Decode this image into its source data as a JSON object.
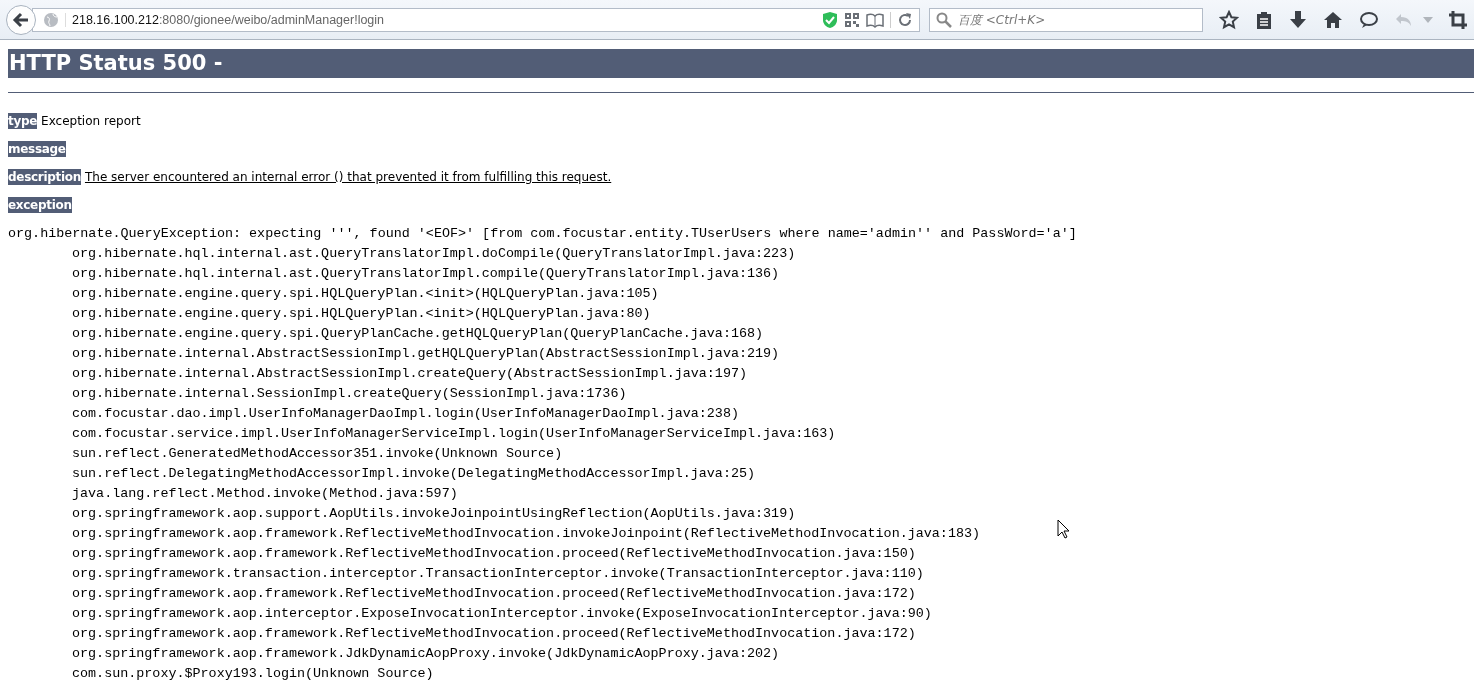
{
  "browser": {
    "url_host": "218.16.100.212",
    "url_path": ":8080/gionee/weibo/adminManager!login",
    "search_placeholder": "百度 <Ctrl+K>"
  },
  "page": {
    "title": "HTTP Status 500 -",
    "fields": [
      {
        "label": "type",
        "value": "Exception report",
        "underlined": false
      },
      {
        "label": "message"
      },
      {
        "label": "description",
        "value": "The server encountered an internal error () that prevented it from fulfilling this request.",
        "underlined": true
      },
      {
        "label": "exception"
      }
    ],
    "exception_header": "org.hibernate.QueryException: expecting ''', found '<EOF>' [from com.focustar.entity.TUserUsers where name='admin'' and PassWord='a']",
    "trace": [
      "org.hibernate.hql.internal.ast.QueryTranslatorImpl.doCompile(QueryTranslatorImpl.java:223)",
      "org.hibernate.hql.internal.ast.QueryTranslatorImpl.compile(QueryTranslatorImpl.java:136)",
      "org.hibernate.engine.query.spi.HQLQueryPlan.<init>(HQLQueryPlan.java:105)",
      "org.hibernate.engine.query.spi.HQLQueryPlan.<init>(HQLQueryPlan.java:80)",
      "org.hibernate.engine.query.spi.QueryPlanCache.getHQLQueryPlan(QueryPlanCache.java:168)",
      "org.hibernate.internal.AbstractSessionImpl.getHQLQueryPlan(AbstractSessionImpl.java:219)",
      "org.hibernate.internal.AbstractSessionImpl.createQuery(AbstractSessionImpl.java:197)",
      "org.hibernate.internal.SessionImpl.createQuery(SessionImpl.java:1736)",
      "com.focustar.dao.impl.UserInfoManagerDaoImpl.login(UserInfoManagerDaoImpl.java:238)",
      "com.focustar.service.impl.UserInfoManagerServiceImpl.login(UserInfoManagerServiceImpl.java:163)",
      "sun.reflect.GeneratedMethodAccessor351.invoke(Unknown Source)",
      "sun.reflect.DelegatingMethodAccessorImpl.invoke(DelegatingMethodAccessorImpl.java:25)",
      "java.lang.reflect.Method.invoke(Method.java:597)",
      "org.springframework.aop.support.AopUtils.invokeJoinpointUsingReflection(AopUtils.java:319)",
      "org.springframework.aop.framework.ReflectiveMethodInvocation.invokeJoinpoint(ReflectiveMethodInvocation.java:183)",
      "org.springframework.aop.framework.ReflectiveMethodInvocation.proceed(ReflectiveMethodInvocation.java:150)",
      "org.springframework.transaction.interceptor.TransactionInterceptor.invoke(TransactionInterceptor.java:110)",
      "org.springframework.aop.framework.ReflectiveMethodInvocation.proceed(ReflectiveMethodInvocation.java:172)",
      "org.springframework.aop.interceptor.ExposeInvocationInterceptor.invoke(ExposeInvocationInterceptor.java:90)",
      "org.springframework.aop.framework.ReflectiveMethodInvocation.proceed(ReflectiveMethodInvocation.java:172)",
      "org.springframework.aop.framework.JdkDynamicAopProxy.invoke(JdkDynamicAopProxy.java:202)",
      "com.sun.proxy.$Proxy193.login(Unknown Source)"
    ]
  }
}
